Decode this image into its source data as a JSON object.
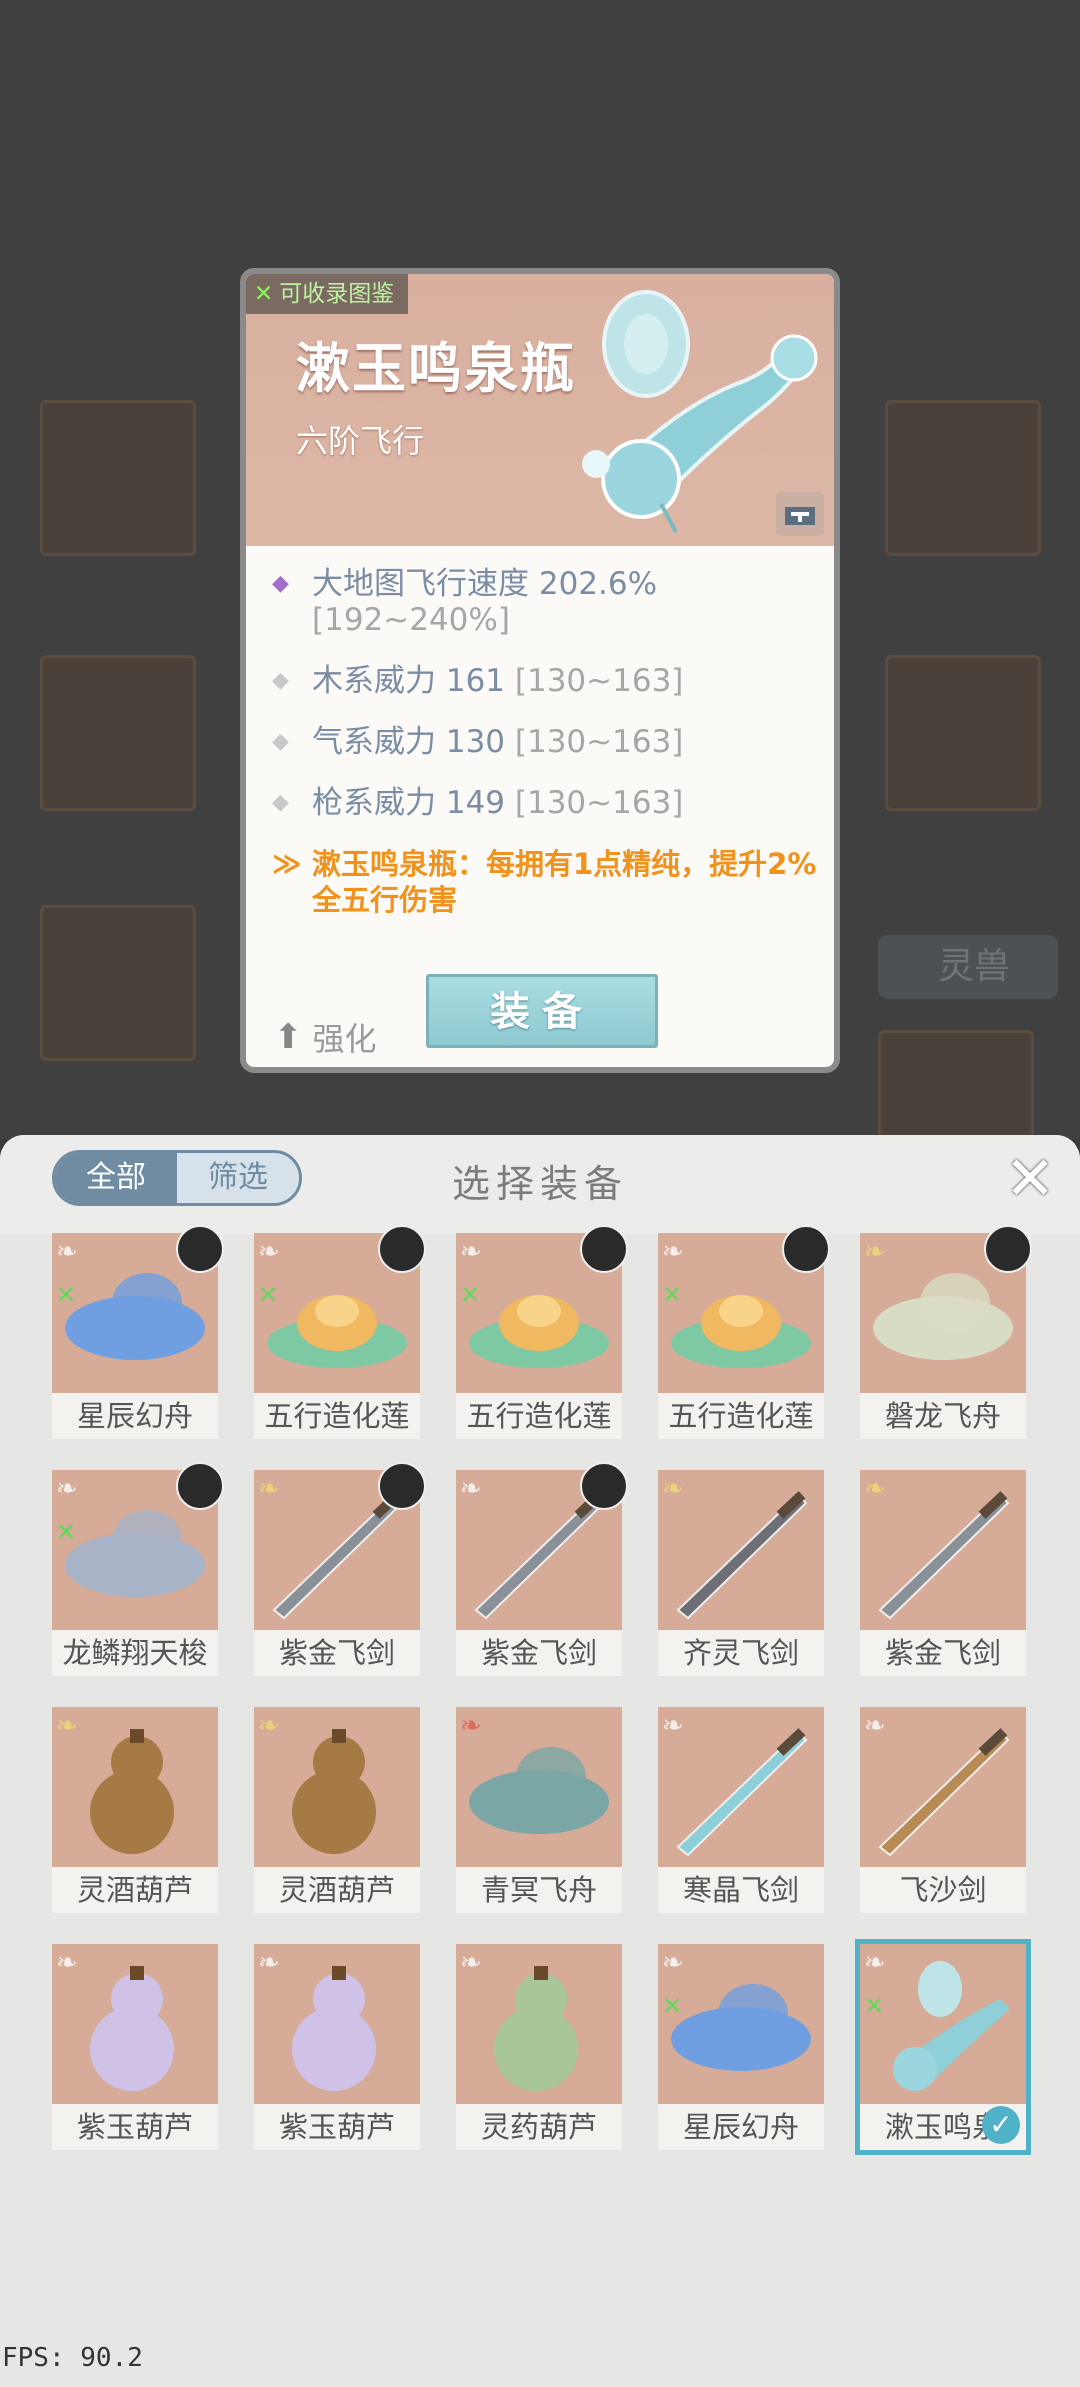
{
  "background": {
    "tag_label": "灵兽"
  },
  "card": {
    "collect_tag": "可收录图鉴",
    "title": "漱玉鸣泉瓶",
    "subtitle": "六阶飞行",
    "stats": [
      {
        "text": "大地图飞行速度 202.6%",
        "range": "[192~240%]",
        "bullet_color": "#a070c8"
      },
      {
        "text": "木系威力 161",
        "range": "[130~163]",
        "bullet_color": "#c8c8c8"
      },
      {
        "text": "气系威力 130",
        "range": "[130~163]",
        "bullet_color": "#c8c8c8"
      },
      {
        "text": "枪系威力 149",
        "range": "[130~163]",
        "bullet_color": "#c8c8c8"
      }
    ],
    "special_text": "漱玉鸣泉瓶：每拥有1点精纯，提升2%全五行伤害",
    "enhance_label": "强化",
    "equip_label": "装备"
  },
  "panel": {
    "tabs": [
      {
        "label": "全部",
        "active": true
      },
      {
        "label": "筛选",
        "active": false
      }
    ],
    "title": "选择装备",
    "close_icon": "close-icon",
    "items": [
      {
        "name": "星辰幻舟",
        "art": "ship-blue",
        "wing": "white",
        "avatar": true,
        "green": true
      },
      {
        "name": "五行造化莲",
        "art": "lotus",
        "wing": "white",
        "avatar": true,
        "green": true
      },
      {
        "name": "五行造化莲",
        "art": "lotus",
        "wing": "white",
        "avatar": true,
        "green": true
      },
      {
        "name": "五行造化莲",
        "art": "lotus",
        "wing": "white",
        "avatar": true,
        "green": true
      },
      {
        "name": "磐龙飞舟",
        "art": "dragon-boat",
        "wing": "gold",
        "avatar": true,
        "green": false
      },
      {
        "name": "龙鳞翔天梭",
        "art": "shuttle",
        "wing": "white",
        "avatar": true,
        "green": true
      },
      {
        "name": "紫金飞剑",
        "art": "sword",
        "wing": "gold",
        "avatar": true,
        "green": false
      },
      {
        "name": "紫金飞剑",
        "art": "sword",
        "wing": "white",
        "avatar": true,
        "green": false
      },
      {
        "name": "齐灵飞剑",
        "art": "sword-dark",
        "wing": "gold",
        "avatar": false,
        "green": false
      },
      {
        "name": "紫金飞剑",
        "art": "sword",
        "wing": "gold",
        "avatar": false,
        "green": false
      },
      {
        "name": "灵酒葫芦",
        "art": "gourd-brown",
        "wing": "gold",
        "avatar": false,
        "green": false
      },
      {
        "name": "灵酒葫芦",
        "art": "gourd-brown",
        "wing": "gold",
        "avatar": false,
        "green": false
      },
      {
        "name": "青冥飞舟",
        "art": "boat-teal",
        "wing": "red",
        "avatar": false,
        "green": false
      },
      {
        "name": "寒晶飞剑",
        "art": "sword-ice",
        "wing": "white",
        "avatar": false,
        "green": false
      },
      {
        "name": "飞沙剑",
        "art": "sword-thin",
        "wing": "white",
        "avatar": false,
        "green": false
      },
      {
        "name": "紫玉葫芦",
        "art": "gourd-purple",
        "wing": "white",
        "avatar": false,
        "green": false
      },
      {
        "name": "紫玉葫芦",
        "art": "gourd-purple",
        "wing": "white",
        "avatar": false,
        "green": false
      },
      {
        "name": "灵药葫芦",
        "art": "gourd-green",
        "wing": "white",
        "avatar": false,
        "green": false
      },
      {
        "name": "星辰幻舟",
        "art": "ship-blue",
        "wing": "white",
        "avatar": false,
        "green": true
      },
      {
        "name": "漱玉鸣泉",
        "art": "vase",
        "wing": "white",
        "avatar": false,
        "green": true,
        "selected": true
      }
    ]
  },
  "fps": "FPS: 90.2"
}
